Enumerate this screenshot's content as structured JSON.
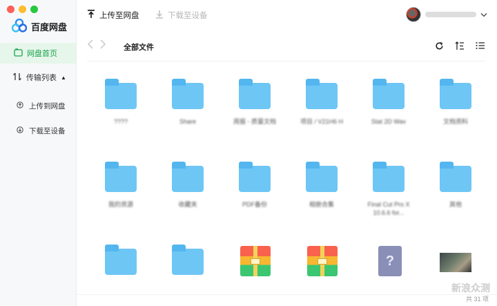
{
  "app": {
    "name": "百度网盘"
  },
  "sidebar": {
    "home": "网盘首页",
    "transfer": "传输列表",
    "transfer_toggle": "▲",
    "upload": "上传到网盘",
    "download": "下载至设备"
  },
  "toolbar": {
    "upload": "上传至网盘",
    "download": "下载至设备"
  },
  "breadcrumb": {
    "current": "全部文件"
  },
  "files": [
    {
      "type": "folder",
      "name": "????"
    },
    {
      "type": "folder",
      "name": "Share"
    },
    {
      "type": "folder",
      "name": "周报 - 质量文档"
    },
    {
      "type": "folder",
      "name": "项目 / V21H6 H"
    },
    {
      "type": "folder",
      "name": "Stat 2D Wav"
    },
    {
      "type": "folder",
      "name": "文档资料"
    },
    {
      "type": "folder",
      "name": "我的资源"
    },
    {
      "type": "folder",
      "name": "收藏夹"
    },
    {
      "type": "folder",
      "name": "PDF备份"
    },
    {
      "type": "folder",
      "name": "相册合集"
    },
    {
      "type": "folder",
      "name": "Final Cut Pro X 10.6.6 for..."
    },
    {
      "type": "folder",
      "name": "其他"
    },
    {
      "type": "folder",
      "name": ""
    },
    {
      "type": "folder",
      "name": ""
    },
    {
      "type": "archive",
      "name": ""
    },
    {
      "type": "archive",
      "name": ""
    },
    {
      "type": "unknown",
      "name": ""
    },
    {
      "type": "image",
      "name": ""
    }
  ],
  "footer": {
    "watermark": "新浪众测",
    "count": "共 31 项"
  },
  "colors": {
    "accent_green": "#19a34a",
    "folder_blue": "#6ec6f5",
    "brand_blue": "#2b8ef3"
  }
}
